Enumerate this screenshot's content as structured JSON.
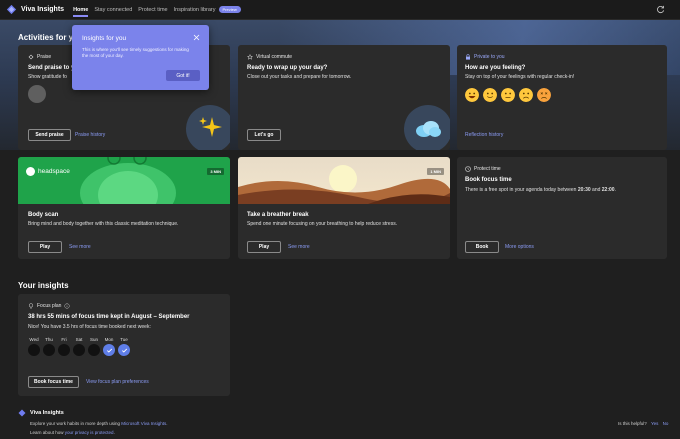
{
  "app": {
    "title": "Viva Insights",
    "tabs": [
      "Home",
      "Stay connected",
      "Protect time",
      "Inspiration library"
    ],
    "preview_badge": "Preview"
  },
  "activities": {
    "title": "Activities for you",
    "popup": {
      "title": "Insights for you",
      "text": "This is where you'll see timely suggestions for making the most of your day.",
      "button": "Got it!"
    },
    "praise": {
      "label": "Praise",
      "heading": "Send praise to y",
      "text": "Show gratitude fo",
      "button": "Send praise",
      "link": "Praise history"
    },
    "commute": {
      "label": "Virtual commute",
      "heading": "Ready to wrap up your day?",
      "text": "Close out your tasks and prepare for tomorrow.",
      "button": "Let's go"
    },
    "feelings": {
      "label": "Private to you",
      "heading": "How are you feeling?",
      "text": "Stay on top of your feelings with regular check-in!",
      "link": "Reflection history",
      "emojis": [
        "happy-emoji",
        "smile-emoji",
        "neutral-emoji",
        "sad-emoji",
        "upset-emoji"
      ]
    },
    "body_scan": {
      "brand": "headspace",
      "duration": "3 MIN",
      "heading": "Body scan",
      "text": "Bring mind and body together with this classic meditation technique.",
      "button": "Play",
      "link": "See more"
    },
    "breather": {
      "duration": "1 MIN",
      "heading": "Take a breather break",
      "text": "Spend one minute focusing on your breathing to help reduce stress.",
      "button": "Play",
      "link": "See more"
    },
    "protect": {
      "label": "Protect time",
      "heading": "Book focus time",
      "text_prefix": "There is a free spot in your agenda today between ",
      "time_start": "20:30",
      "text_and": " and ",
      "time_end": "22:00",
      "text_suffix": ".",
      "button": "Book",
      "link": "More options"
    }
  },
  "insights": {
    "title": "Your insights",
    "focus": {
      "label": "Focus plan",
      "heading": "38 hrs 55 mins of focus time kept in August – September",
      "text": "Nice! You have 3.5 hrs of focus time booked next week:",
      "days": [
        {
          "name": "Wed",
          "done": false
        },
        {
          "name": "Thu",
          "done": false
        },
        {
          "name": "Fri",
          "done": false
        },
        {
          "name": "Sat",
          "done": false
        },
        {
          "name": "Sun",
          "done": false
        },
        {
          "name": "Mon",
          "done": true
        },
        {
          "name": "Tue",
          "done": true
        }
      ],
      "button": "Book focus time",
      "link": "View focus plan preferences"
    }
  },
  "footer": {
    "title": "Viva Insights",
    "line1_prefix": "Explore your work habits in more depth using ",
    "line1_link": "Microsoft Viva Insights",
    "line1_suffix": ".",
    "line2_prefix": "Learn about how ",
    "line2_link": "your privacy is protected",
    "line2_suffix": ".",
    "helpful": "Is this helpful?",
    "yes": "Yes",
    "no": "No"
  },
  "colors": {
    "accent": "#7b83eb",
    "link": "#8b9cf5",
    "card": "#2b2b2b",
    "background": "#1f1f1f",
    "headspace_green": "#1fa34a"
  }
}
